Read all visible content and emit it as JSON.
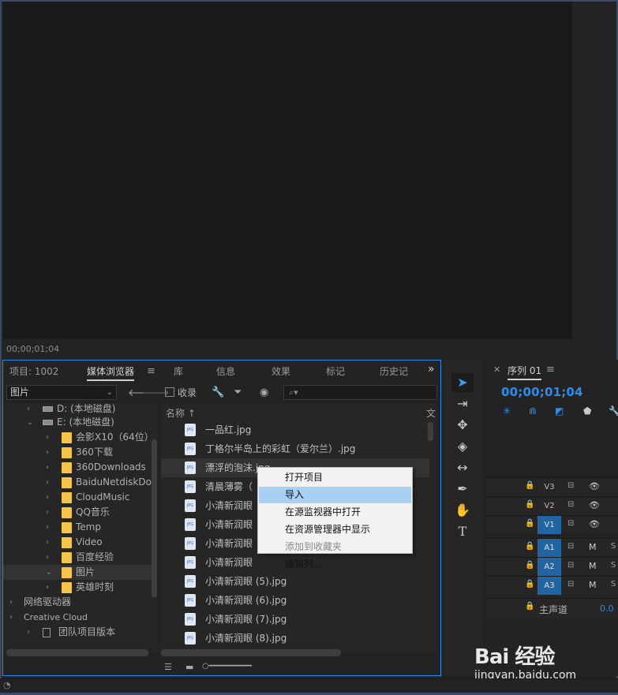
{
  "monitor": {
    "timecode": "00;00;01;04"
  },
  "media_browser": {
    "tabs": [
      {
        "label": "项目: 1002"
      },
      {
        "label": "媒体浏览器"
      },
      {
        "label": "库"
      },
      {
        "label": "信息"
      },
      {
        "label": "效果"
      },
      {
        "label": "标记"
      },
      {
        "label": "历史记"
      }
    ],
    "more_label": "»",
    "location": "图片",
    "ingest_label": "收录",
    "tree": [
      {
        "label": "D: (本地磁盘)",
        "type": "drive",
        "expanded": false
      },
      {
        "label": "E: (本地磁盘)",
        "type": "drive",
        "expanded": true
      },
      {
        "label": "会影X10（64位）",
        "type": "folder"
      },
      {
        "label": "360下载",
        "type": "folder"
      },
      {
        "label": "360Downloads",
        "type": "folder"
      },
      {
        "label": "BaiduNetdiskDown",
        "type": "folder"
      },
      {
        "label": "CloudMusic",
        "type": "folder"
      },
      {
        "label": "QQ音乐",
        "type": "folder"
      },
      {
        "label": "Temp",
        "type": "folder"
      },
      {
        "label": "Video",
        "type": "folder"
      },
      {
        "label": "百度经验",
        "type": "folder"
      },
      {
        "label": "图片",
        "type": "folder",
        "expanded": true,
        "selected": true
      },
      {
        "label": "英雄时刻",
        "type": "folder"
      },
      {
        "label": "网络驱动器",
        "type": "section"
      },
      {
        "label": "Creative Cloud",
        "type": "section"
      },
      {
        "label": "团队项目版本",
        "type": "item"
      }
    ],
    "columns": {
      "name": "名称",
      "other": "文"
    },
    "files": [
      "一品红.jpg",
      "丁格尔半岛上的彩虹（爱尔兰）.jpg",
      "漂浮的泡沫.jpg",
      "清晨薄雾（",
      "小清新润眼",
      "小清新润眼",
      "小清新润眼",
      "小清新润眼",
      "小清新润眼 (5).jpg",
      "小清新润眼 (6).jpg",
      "小清新润眼 (7).jpg",
      "小清新润眼 (8).jpg"
    ],
    "file_icon_text": "JPG"
  },
  "context_menu": {
    "items": [
      {
        "label": "打开项目",
        "state": "normal"
      },
      {
        "label": "导入",
        "state": "hover"
      },
      {
        "label": "在源监视器中打开",
        "state": "normal"
      },
      {
        "label": "在资源管理器中显示",
        "state": "normal"
      },
      {
        "label": "添加到收藏夹",
        "state": "disabled"
      },
      {
        "label": "编辑列...",
        "state": "normal"
      }
    ]
  },
  "timeline": {
    "title": "序列 01",
    "timecode": "00;00;01;04",
    "tracks": [
      {
        "name": "V3",
        "on": false,
        "a": "⊟",
        "b": "👁",
        "c": ""
      },
      {
        "name": "V2",
        "on": false,
        "a": "⊟",
        "b": "👁",
        "c": ""
      },
      {
        "name": "V1",
        "on": true,
        "a": "⊟",
        "b": "👁",
        "c": ""
      },
      {
        "name": "A1",
        "on": true,
        "a": "⊟",
        "b": "M",
        "c": "S"
      },
      {
        "name": "A2",
        "on": true,
        "a": "⊟",
        "b": "M",
        "c": "S"
      },
      {
        "name": "A3",
        "on": true,
        "a": "⊟",
        "b": "M",
        "c": "S"
      }
    ],
    "master_label": "主声道",
    "master_value": "0.0"
  },
  "watermark": {
    "logo": "Bai 经验",
    "url": "jingyan.baidu.com"
  },
  "colors": {
    "accent": "#2d8ceb",
    "folder": "#f3c54a",
    "menu_hover": "#a9cff3"
  }
}
